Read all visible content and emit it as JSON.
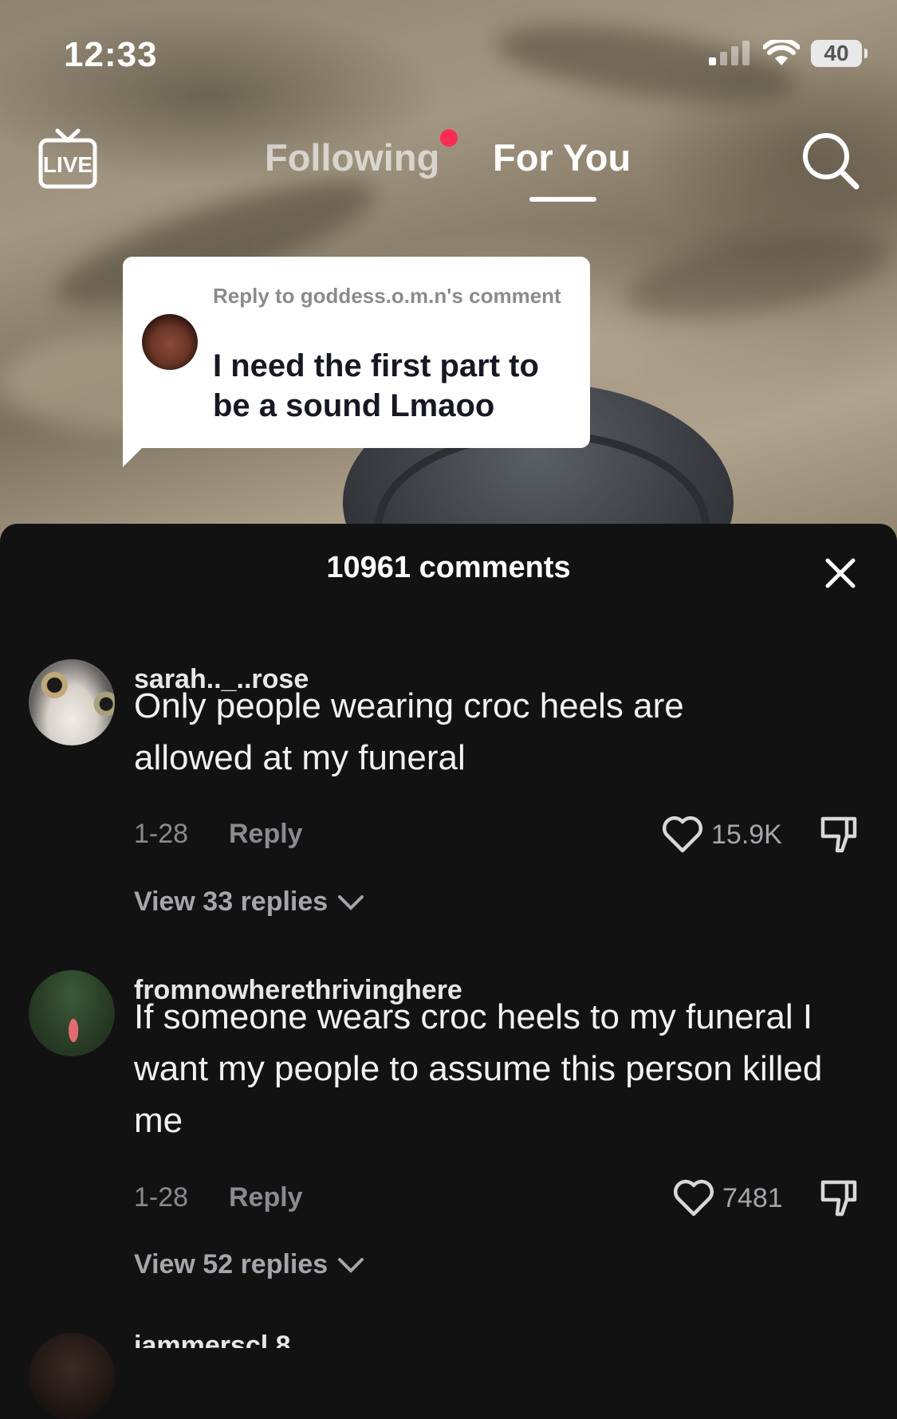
{
  "status_bar": {
    "time": "12:33",
    "battery": "40"
  },
  "top_nav": {
    "tabs": [
      {
        "label": "Following",
        "active": false
      },
      {
        "label": "For You",
        "active": true
      }
    ]
  },
  "reply_card": {
    "meta": "Reply to goddess.o.m.n's comment",
    "text": "I need the first part to be a sound Lmaoo"
  },
  "comments_sheet": {
    "title": "10961 comments",
    "comments": [
      {
        "username": "sarah.._..rose",
        "text": "Only people wearing croc heels are allowed at my funeral",
        "date": "1-28",
        "reply_label": "Reply",
        "likes": "15.9K",
        "view_replies": "View 33 replies"
      },
      {
        "username": "fromnowherethrivinghere",
        "text": "If someone wears croc heels to my funeral I want my people to assume this person killed me",
        "date": "1-28",
        "reply_label": "Reply",
        "likes": "7481",
        "view_replies": "View 52 replies"
      }
    ],
    "next_username_partial": "jammerscl 8"
  },
  "colors": {
    "accent_dot": "#fe2c55",
    "sheet_bg": "#121212"
  }
}
